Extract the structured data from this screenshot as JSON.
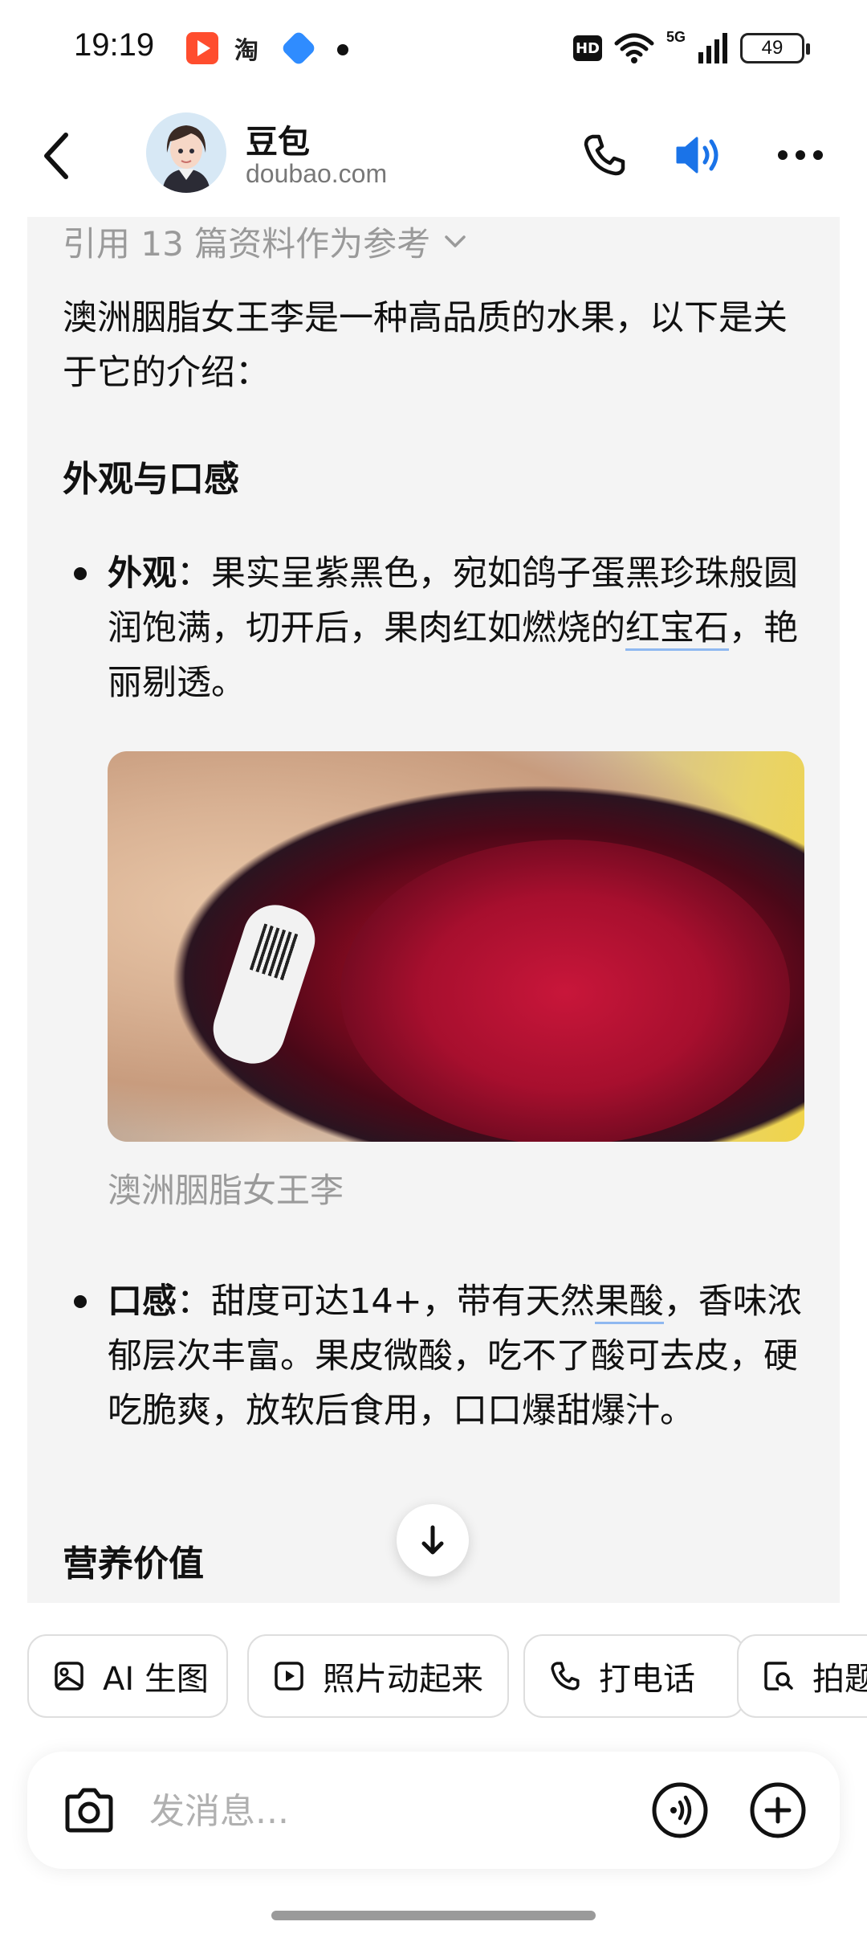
{
  "status_bar": {
    "time": "19:19",
    "notifications": [
      "video-app-icon",
      "taobao-icon",
      "blue-app-icon",
      "dot"
    ],
    "taobao_glyph": "淘",
    "hd": "HD",
    "network": "5G",
    "battery": "49"
  },
  "header": {
    "bot_name": "豆包",
    "bot_domain": "doubao.com",
    "icons": [
      "back-icon",
      "phone-icon",
      "speaker-icon",
      "more-icon"
    ],
    "accent_color": "#1a73e8"
  },
  "message": {
    "reference": "引用 13 篇资料作为参考",
    "intro": "澳洲胭脂女王李是一种高品质的水果，以下是关于它的介绍：",
    "section_appearance": "外观与口感",
    "appearance_label": "外观",
    "appearance_text_1": "：果实呈紫黑色，宛如鸽子蛋黑珍珠般圆润饱满，切开后，果肉红如燃烧的",
    "appearance_link": "红宝石",
    "appearance_text_2": "，艳丽剔透。",
    "image_caption": "澳洲胭脂女王李",
    "taste_label": "口感",
    "taste_text_1": "：甜度可达14+，带有天然",
    "taste_link": "果酸",
    "taste_text_2": "，香味浓郁层次丰富。果皮微酸，吃不了酸可去皮，硬吃脆爽，放软后食用，口口爆甜爆汁。",
    "section_nutrition": "营养价值"
  },
  "chips": [
    {
      "label": "AI 生图",
      "icon": "image-icon"
    },
    {
      "label": "照片动起来",
      "icon": "play-icon"
    },
    {
      "label": "打电话",
      "icon": "phone-icon"
    },
    {
      "label": "拍题",
      "icon": "scan-question-icon"
    }
  ],
  "composer": {
    "placeholder": "发消息..."
  }
}
